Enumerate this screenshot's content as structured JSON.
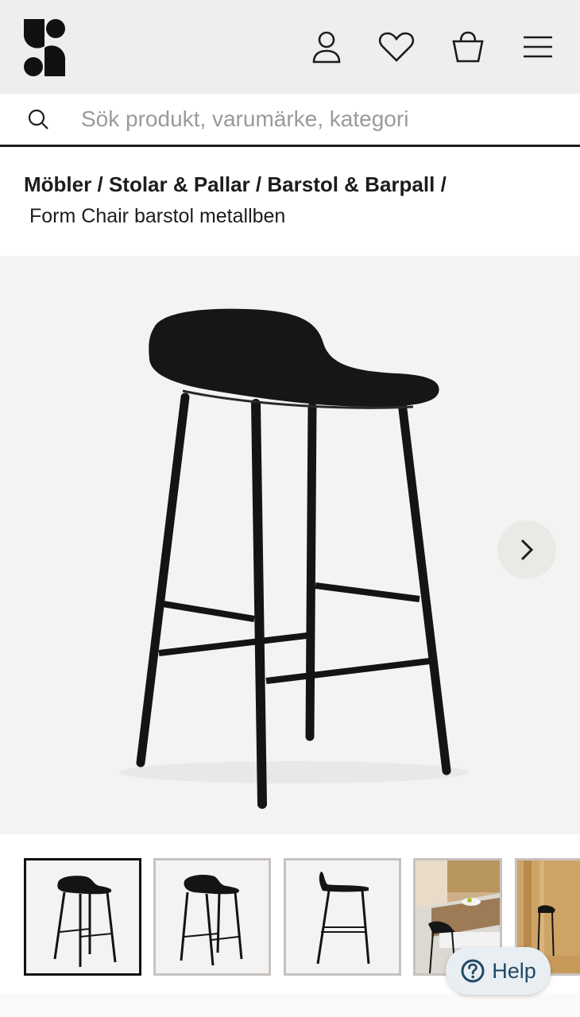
{
  "header": {
    "logo_name": "S",
    "icons": [
      "account-icon",
      "heart-icon",
      "basket-icon",
      "menu-icon"
    ]
  },
  "search": {
    "placeholder": "Sök produkt, varumärke, kategori"
  },
  "breadcrumb": {
    "items": [
      "Möbler",
      "Stolar & Pallar",
      "Barstol & Barpall"
    ],
    "separator": "/",
    "current": "Form Chair barstol metallben"
  },
  "gallery": {
    "thumbnail_count": 5,
    "active_index": 0
  },
  "help": {
    "label": "Help"
  },
  "colors": {
    "header_bg": "#efeeec",
    "hero_bg": "#f3f3f3",
    "text": "#1c1c1c",
    "help_text": "#1f4a66"
  }
}
